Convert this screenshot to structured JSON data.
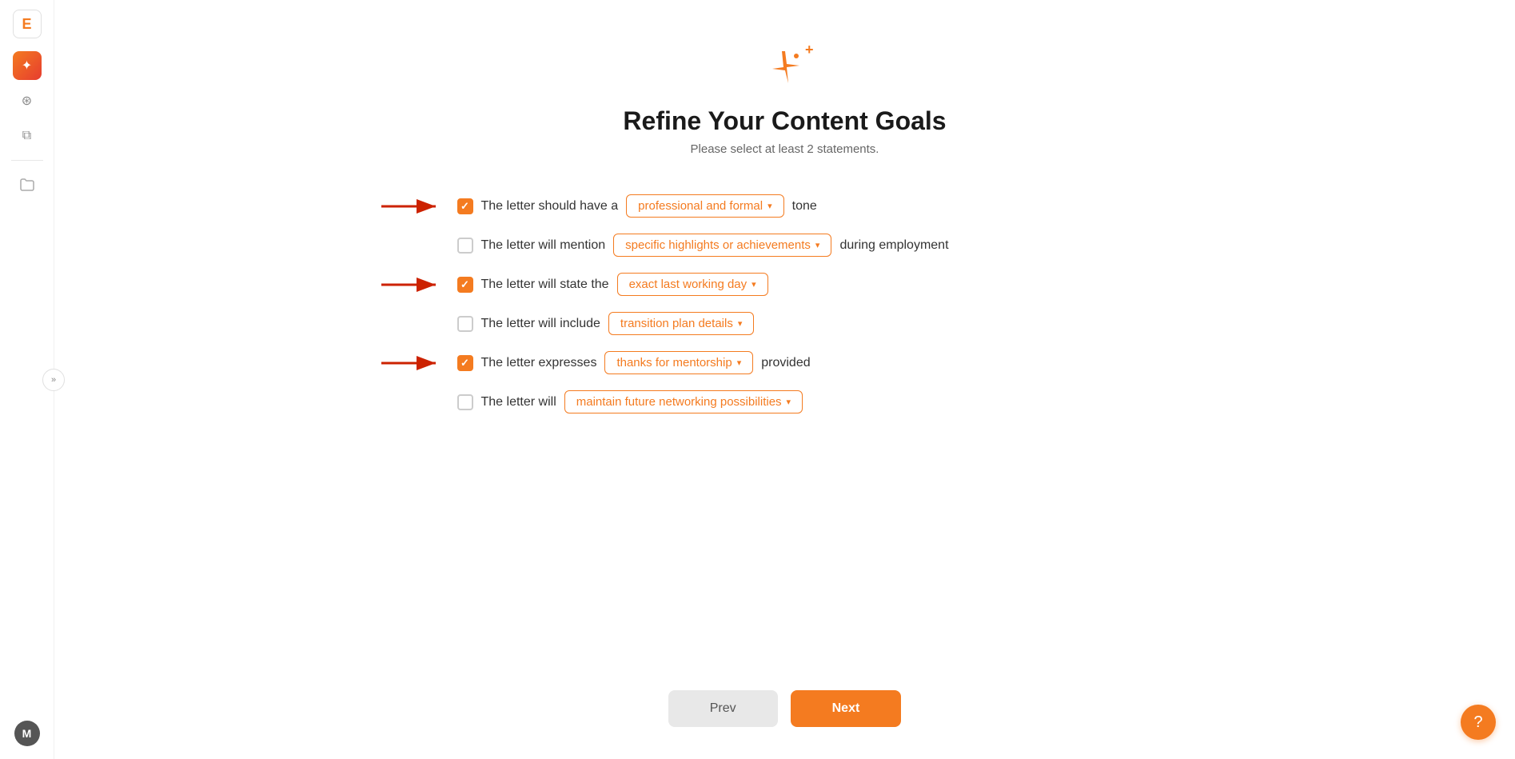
{
  "sidebar": {
    "logo_letter": "E",
    "icons": [
      {
        "name": "magic-icon",
        "symbol": "✦",
        "active": true
      },
      {
        "name": "webhook-icon",
        "symbol": "⊕",
        "active": false
      },
      {
        "name": "document-icon",
        "symbol": "⧉",
        "active": false
      }
    ],
    "collapse_label": "»",
    "folder_icon": "🗀",
    "avatar_letter": "M"
  },
  "page": {
    "sparkle": "✦",
    "title": "Refine Your Content Goals",
    "subtitle": "Please select at least 2 statements."
  },
  "statements": [
    {
      "id": "tone",
      "checked": true,
      "prefix": "The letter should have a",
      "dropdown_value": "professional and formal",
      "suffix": "tone",
      "has_arrow": true
    },
    {
      "id": "highlights",
      "checked": false,
      "prefix": "The letter will mention",
      "dropdown_value": "specific highlights or achievements",
      "suffix": "during employment",
      "has_arrow": false
    },
    {
      "id": "lastday",
      "checked": true,
      "prefix": "The letter will state the",
      "dropdown_value": "exact last working day",
      "suffix": "",
      "has_arrow": true
    },
    {
      "id": "transition",
      "checked": false,
      "prefix": "The letter will include",
      "dropdown_value": "transition plan details",
      "suffix": "",
      "has_arrow": false
    },
    {
      "id": "mentorship",
      "checked": true,
      "prefix": "The letter expresses",
      "dropdown_value": "thanks for mentorship",
      "suffix": "provided",
      "has_arrow": true
    },
    {
      "id": "networking",
      "checked": false,
      "prefix": "The letter will",
      "dropdown_value": "maintain future networking possibilities",
      "suffix": "",
      "has_arrow": false
    }
  ],
  "buttons": {
    "prev_label": "Prev",
    "next_label": "Next"
  },
  "support": {
    "icon": "?"
  }
}
